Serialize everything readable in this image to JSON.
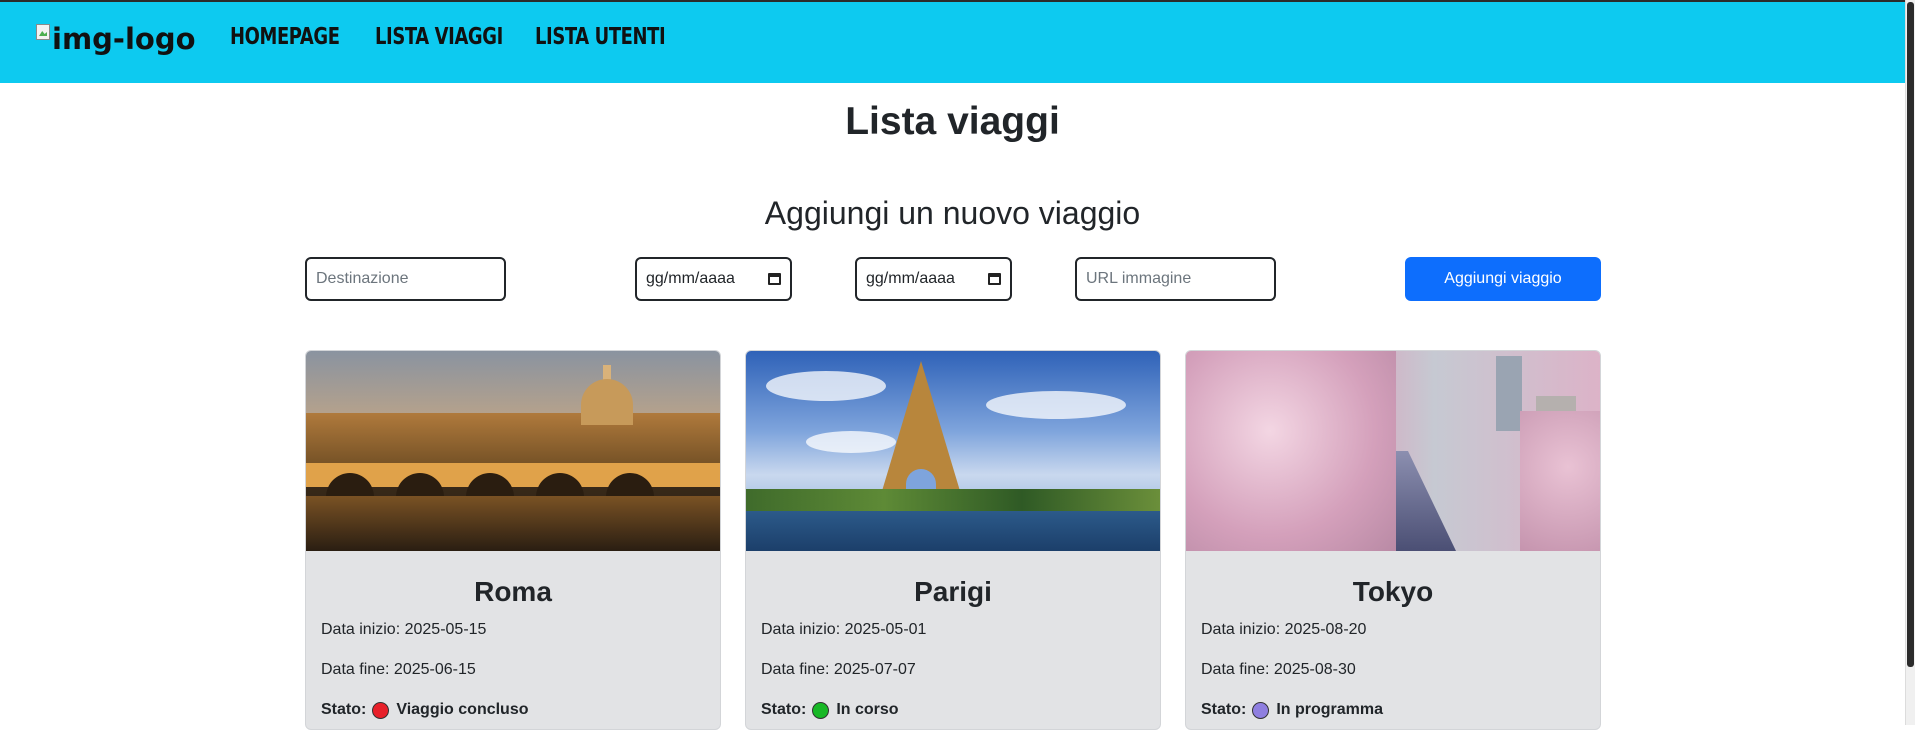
{
  "nav": {
    "logo_alt": "img-logo",
    "links": [
      "HOMEPAGE",
      "LISTA VIAGGI",
      "LISTA UTENTI"
    ]
  },
  "page": {
    "title": "Lista viaggi",
    "form_title": "Aggiungi un nuovo viaggio"
  },
  "form": {
    "destination_placeholder": "Destinazione",
    "start_date_placeholder": "gg/mm/aaaa",
    "end_date_placeholder": "gg/mm/aaaa",
    "image_url_placeholder": "URL immagine",
    "submit_label": "Aggiungi viaggio"
  },
  "colors": {
    "navbar": "#0dcaf0",
    "primary": "#0d6efd",
    "card_body": "#e2e3e5",
    "status_concluded": "#e8202a",
    "status_in_progress": "#18b826",
    "status_planned": "#8f7fe0"
  },
  "trips": [
    {
      "name": "Roma",
      "start": "Data inizio: 2025-05-15",
      "end": "Data fine: 2025-06-15",
      "state_label": "Stato:",
      "state": "Viaggio concluso"
    },
    {
      "name": "Parigi",
      "start": "Data inizio: 2025-05-01",
      "end": "Data fine: 2025-07-07",
      "state_label": "Stato:",
      "state": "In corso"
    },
    {
      "name": "Tokyo",
      "start": "Data inizio: 2025-08-20",
      "end": "Data fine: 2025-08-30",
      "state_label": "Stato:",
      "state": "In programma"
    }
  ]
}
